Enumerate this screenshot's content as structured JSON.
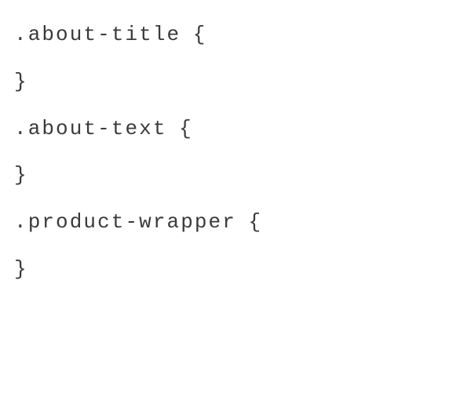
{
  "code": {
    "rules": [
      {
        "dot": ".",
        "selector": "about-title",
        "open": "{",
        "close": "}"
      },
      {
        "dot": ".",
        "selector": "about-text",
        "open": "{",
        "close": "}"
      },
      {
        "dot": ".",
        "selector": "product-wrapper",
        "open": "{",
        "close": "}"
      }
    ]
  }
}
